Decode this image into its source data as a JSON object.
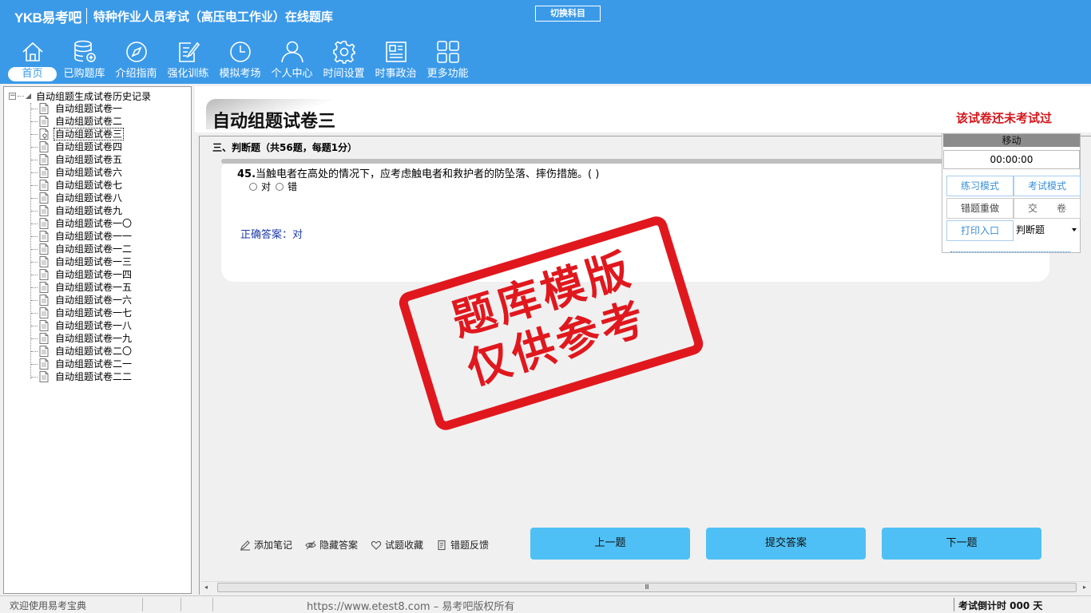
{
  "header": {
    "logo": "YKB易考吧",
    "title": "特种作业人员考试（高压电工作业）在线题库",
    "switch_label": "切换科目"
  },
  "nav": [
    {
      "label": "首页",
      "icon": "home-icon"
    },
    {
      "label": "已购题库",
      "icon": "database-icon"
    },
    {
      "label": "介绍指南",
      "icon": "compass-icon"
    },
    {
      "label": "强化训练",
      "icon": "edit-icon"
    },
    {
      "label": "模拟考场",
      "icon": "clock-icon"
    },
    {
      "label": "个人中心",
      "icon": "user-icon"
    },
    {
      "label": "时间设置",
      "icon": "gear-icon"
    },
    {
      "label": "时事政治",
      "icon": "news-icon"
    },
    {
      "label": "更多功能",
      "icon": "grid-icon"
    }
  ],
  "tree": {
    "root": "自动组题生成试卷历史记录",
    "items": [
      "自动组题试卷一",
      "自动组题试卷二",
      "自动组题试卷三",
      "自动组题试卷四",
      "自动组题试卷五",
      "自动组题试卷六",
      "自动组题试卷七",
      "自动组题试卷八",
      "自动组题试卷九",
      "自动组题试卷一〇",
      "自动组题试卷一一",
      "自动组题试卷一二",
      "自动组题试卷一三",
      "自动组题试卷一四",
      "自动组题试卷一五",
      "自动组题试卷一六",
      "自动组题试卷一七",
      "自动组题试卷一八",
      "自动组题试卷一九",
      "自动组题试卷二〇",
      "自动组题试卷二一",
      "自动组题试卷二二"
    ],
    "selected_index": 2
  },
  "paper": {
    "title": "自动组题试卷三",
    "status": "该试卷还未考试过",
    "section": "三、判断题（共56题，每题1分）",
    "question_number": "45.",
    "question_text": "当触电者在高处的情况下，应考虑触电者和救护者的防坠落、摔伤措施。( )",
    "options": [
      "对",
      "错"
    ],
    "answer": "正确答案：对"
  },
  "control": {
    "head": "移动",
    "timer": "00:00:00",
    "practice_mode": "练习模式",
    "exam_mode": "考试模式",
    "redo_wrong": "错题重做",
    "submit_paper": "交　　卷",
    "print_entry": "打印入口",
    "type_select": "判断题"
  },
  "tools": {
    "add_note": "添加笔记",
    "hide_answer": "隐藏答案",
    "favorite": "试题收藏",
    "feedback": "错题反馈"
  },
  "buttons": {
    "prev": "上一题",
    "submit": "提交答案",
    "next": "下一题"
  },
  "watermark": {
    "line1": "题库模版",
    "line2": "仅供参考"
  },
  "statusbar": {
    "welcome": "欢迎使用易考宝典",
    "copyright": "https://www.etest8.com – 易考吧版权所有",
    "countdown": "考试倒计时 000 天"
  },
  "scrollbar": {
    "thumb_grip": "Ⅲ",
    "left_arrow": "◂",
    "right_arrow": "▸"
  },
  "colors": {
    "header_bg": "#3b9ae8",
    "accent_red": "#d4161b",
    "button_blue": "#4ec0f5",
    "answer_blue": "#1d3aa8"
  }
}
